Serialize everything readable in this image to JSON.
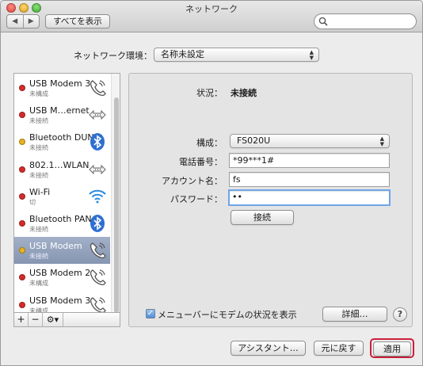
{
  "window": {
    "title": "ネットワーク",
    "show_all": "すべてを表示",
    "nav_back": "◀",
    "nav_forward": "▶",
    "search_placeholder": ""
  },
  "location": {
    "label": "ネットワーク環境：",
    "value": "名称未設定"
  },
  "services": [
    {
      "name": "USB Modem 3",
      "status": "未構成",
      "dot": "#d62b2b",
      "icon": "phone-modem-icon"
    },
    {
      "name": "USB M…ernet",
      "status": "未接続",
      "dot": "#d62b2b",
      "icon": "ethernet-arrows-icon"
    },
    {
      "name": "Bluetooth DUN",
      "status": "未接続",
      "dot": "#e9b21f",
      "icon": "bluetooth-icon"
    },
    {
      "name": "802.1…WLAN",
      "status": "未接続",
      "dot": "#d62b2b",
      "icon": "ethernet-arrows-icon"
    },
    {
      "name": "Wi-Fi",
      "status": "切",
      "dot": "#d62b2b",
      "icon": "wifi-icon"
    },
    {
      "name": "Bluetooth PAN",
      "status": "未接続",
      "dot": "#d62b2b",
      "icon": "bluetooth-icon"
    },
    {
      "name": "USB Modem",
      "status": "未接続",
      "dot": "#e9b21f",
      "icon": "phone-modem-icon",
      "selected": true
    },
    {
      "name": "USB Modem 2",
      "status": "未構成",
      "dot": "#d62b2b",
      "icon": "phone-modem-icon"
    },
    {
      "name": "USB Modem 3",
      "status": "未構成",
      "dot": "#d62b2b",
      "icon": "phone-modem-icon"
    }
  ],
  "sidebar_tools": {
    "add": "+",
    "remove": "−",
    "gear": "⚙▾"
  },
  "detail": {
    "status_label": "状況：",
    "status_value": "未接続",
    "config_label": "構成：",
    "config_value": "FS020U",
    "phone_label": "電話番号：",
    "phone_value": "*99***1#",
    "account_label": "アカウント名：",
    "account_value": "fs",
    "password_label": "パスワード：",
    "password_value": "••",
    "connect_button": "接続",
    "menubar_checkbox_label": "メニューバーにモデムの状況を表示",
    "advanced_button": "詳細…",
    "help_button": "?"
  },
  "footer": {
    "assistant_button": "アシスタント…",
    "revert_button": "元に戻す",
    "apply_button": "適用"
  },
  "colors": {
    "selection": "#8695b1",
    "apply_highlight": "#cc1f3a",
    "focus_ring": "#6fa6e6"
  }
}
